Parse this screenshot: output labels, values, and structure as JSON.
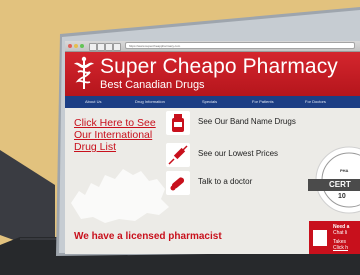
{
  "browser": {
    "url": "https://www.supercheappharmacy.com",
    "buttons": [
      "back-button",
      "forward-button",
      "reload-button",
      "home-button"
    ]
  },
  "site": {
    "title": "Super Cheapo Pharmacy",
    "subtitle": "Best Canadian Drugs",
    "logo": "caduceus-icon"
  },
  "nav": {
    "items": [
      {
        "label": "About Us"
      },
      {
        "label": "Drug Information"
      },
      {
        "label": "Specials"
      },
      {
        "label": "For Patients"
      },
      {
        "label": "For Doctors"
      }
    ]
  },
  "main": {
    "intl_link": "Click Here to See Our International Drug List",
    "features": [
      {
        "label": "See Our Band Name  Drugs",
        "icon": "pill-bottle-icon"
      },
      {
        "label": "See our Lowest Prices",
        "icon": "syringe-icon"
      },
      {
        "label": "Talk to a doctor",
        "icon": "capsule-icon"
      }
    ],
    "pharmacist_text": "We have a licensed pharmacist",
    "background_icon": "canada-map-icon"
  },
  "seal": {
    "small": "PHA",
    "text": "CERT",
    "percent": "10",
    "icon": "certified-seal-icon"
  },
  "chat": {
    "line1": "Need a",
    "line2": "Chat li",
    "line3": "Takes",
    "line4": "Click h"
  },
  "colors": {
    "brand_red": "#c8101c",
    "nav_blue": "#1c3e84",
    "desk_tan": "#e2c27e",
    "laptop_base": "#27292c"
  }
}
